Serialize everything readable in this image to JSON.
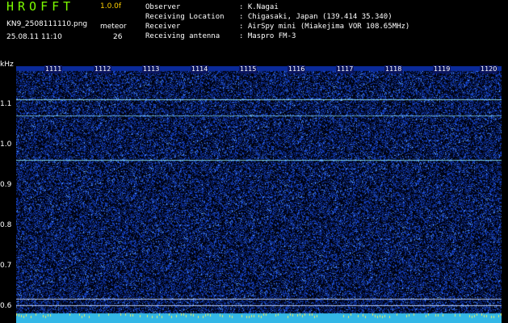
{
  "header": {
    "app_title": "HROFFT",
    "version": "1.0.0f",
    "filename": "KN9_2508111110.png",
    "mode": "meteor",
    "datetime": "25.08.11 11:10",
    "count": "26"
  },
  "info": [
    {
      "label": "Observer",
      "value": ": K.Nagai"
    },
    {
      "label": "Receiving Location",
      "value": ": Chigasaki, Japan (139.414 35.340)"
    },
    {
      "label": "Receiver",
      "value": ": AirSpy mini (Miakejima VOR 108.65MHz)"
    },
    {
      "label": "Receiving antenna",
      "value": ": Maspro FM-3"
    }
  ],
  "axis": {
    "y_unit": "kHz",
    "y_ticks": [
      "1.1",
      "1.0",
      "0.9",
      "0.8",
      "0.7",
      "0.6"
    ],
    "x_ticks": [
      "1111",
      "1112",
      "1113",
      "1114",
      "1115",
      "1116",
      "1117",
      "1118",
      "1119",
      "1120"
    ]
  },
  "colors": {
    "background": "#000000",
    "title": "#7CFC00",
    "accent_yellow": "#FFD000",
    "noise": "#1e46ff",
    "line": "#b4ffff"
  }
}
